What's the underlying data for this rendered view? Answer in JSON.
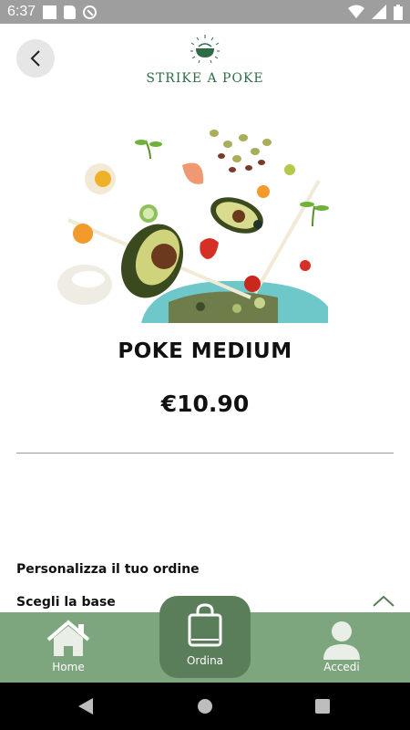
{
  "status_bar": {
    "time": "6:37",
    "icons": [
      "square-icon",
      "sd-card-icon",
      "data-saver-icon",
      "wifi-icon",
      "signal-icon",
      "battery-icon"
    ]
  },
  "header": {
    "back_icon": "chevron-left-icon",
    "logo_text": "STRIKE A POKE"
  },
  "product": {
    "image": "poke-ingredients-image",
    "name": "POKE MEDIUM",
    "price": "€10.90"
  },
  "customize": {
    "section_title": "Personalizza il tuo ordine",
    "base_title": "Scegli la base",
    "expand_icon": "chevron-up-icon"
  },
  "bottom_nav": {
    "home_label": "Home",
    "order_label": "Ordina",
    "login_label": "Accedi"
  },
  "colors": {
    "nav_green": "#7ea67e",
    "order_green": "#5a7d5a",
    "logo_green": "#2f6b45",
    "status_bar": "#9e9e9e"
  },
  "system_nav": {
    "icons": [
      "back-triangle-icon",
      "home-circle-icon",
      "recents-square-icon"
    ]
  }
}
